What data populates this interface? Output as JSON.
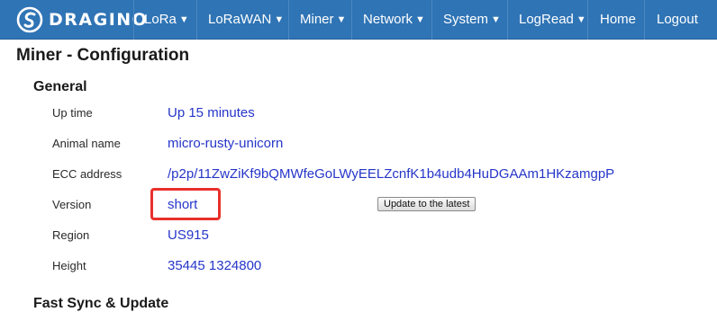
{
  "header": {
    "brand_name": "DRAGINO",
    "brand_logo_icon": "dragino-swirl-icon",
    "nav": [
      {
        "label": "LoRa",
        "has_dropdown": true
      },
      {
        "label": "LoRaWAN",
        "has_dropdown": true
      },
      {
        "label": "Miner",
        "has_dropdown": true
      },
      {
        "label": "Network",
        "has_dropdown": true
      },
      {
        "label": "System",
        "has_dropdown": true
      },
      {
        "label": "LogRead",
        "has_dropdown": true
      },
      {
        "label": "Home",
        "has_dropdown": false
      },
      {
        "label": "Logout",
        "has_dropdown": false
      }
    ],
    "dropdown_icon": "caret-down-icon"
  },
  "page": {
    "title": "Miner - Configuration"
  },
  "general": {
    "title": "General",
    "rows": [
      {
        "label": "Up time",
        "value": "Up 15 minutes"
      },
      {
        "label": "Animal name",
        "value": "micro-rusty-unicorn"
      },
      {
        "label": "ECC address",
        "value": "/p2p/11ZwZiKf9bQMWfeGoLWyEELZcnfK1b4udb4HuDGAAm1HKzamgpP"
      },
      {
        "label": "Version",
        "value": "short"
      },
      {
        "label": "Region",
        "value": "US915"
      },
      {
        "label": "Height",
        "value": "35445 1324800"
      }
    ],
    "update_button_label": "Update to the latest"
  },
  "fast_sync": {
    "title": "Fast Sync & Update"
  },
  "colors": {
    "navbar": "#2f74b5",
    "value_text": "#2535c9",
    "highlight_border": "#e8302b"
  }
}
